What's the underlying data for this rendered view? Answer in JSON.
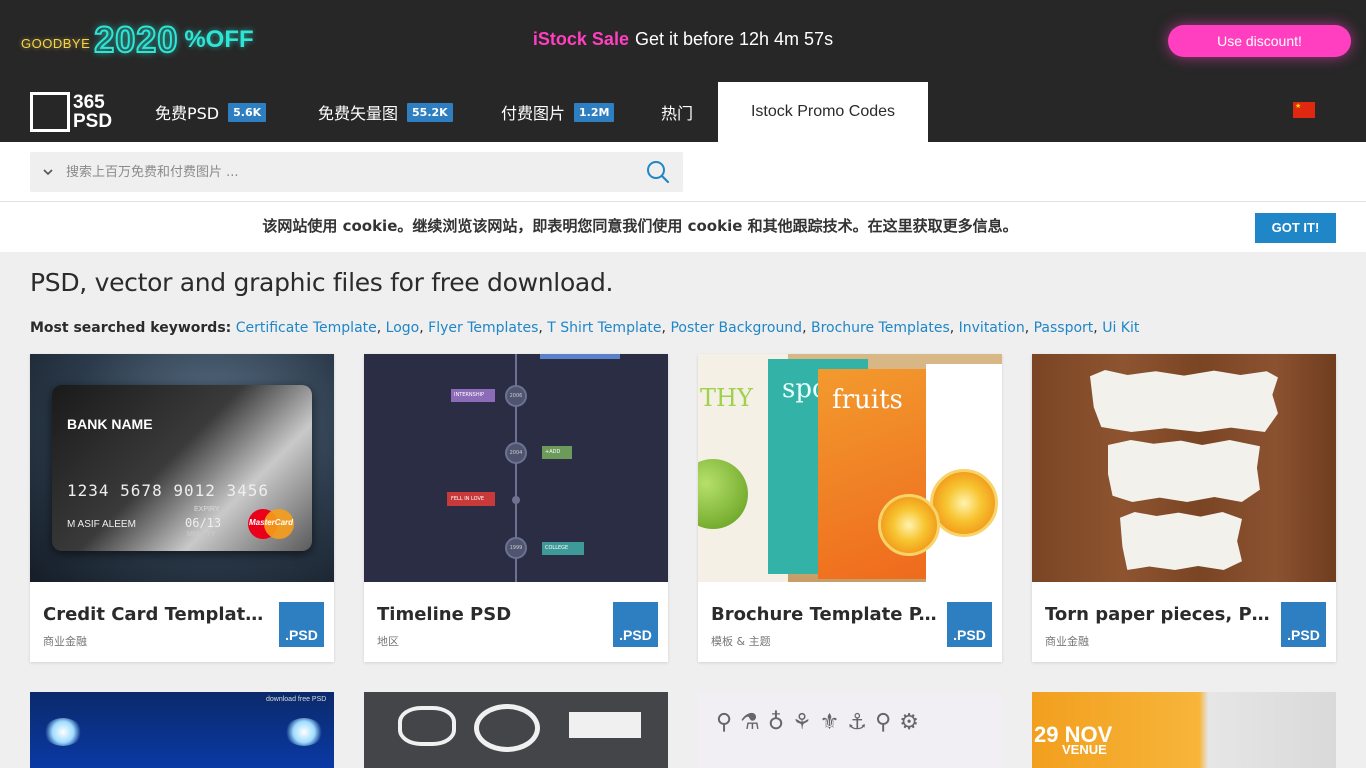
{
  "promo": {
    "goodbye": "GOODBYE",
    "year": "2020",
    "off": "%OFF",
    "brand": "iStock Sale",
    "message": "Get it before 12h 4m 57s",
    "button": "Use discount!"
  },
  "nav": {
    "logo_line1": "365",
    "logo_line2": "PSD",
    "items": [
      {
        "label": "免费PSD",
        "badge": "5.6K"
      },
      {
        "label": "免费矢量图",
        "badge": "55.2K"
      },
      {
        "label": "付费图片",
        "badge": "1.2M"
      },
      {
        "label": "热门",
        "badge": ""
      }
    ],
    "active": "Istock Promo Codes"
  },
  "search": {
    "placeholder": "搜索上百万免费和付费图片 ..."
  },
  "cookie": {
    "text": "该网站使用 cookie。继续浏览该网站，即表明您同意我们使用 cookie 和其他跟踪技术。在这里获取更多信息。",
    "button": "GOT IT!"
  },
  "page_title": "PSD, vector and graphic files for free download.",
  "keywords": {
    "label": "Most searched keywords:",
    "items": [
      "Certificate Template",
      "Logo",
      "Flyer Templates",
      "T Shirt Template",
      "Poster Background",
      "Brochure Templates",
      "Invitation",
      "Passport",
      "Ui Kit"
    ]
  },
  "cards": [
    {
      "title": "Credit Card Template ...",
      "category": "商业金融",
      "badge": ".PSD",
      "thumb": {
        "bank": "BANK NAME",
        "number": "1234 5678 9012 3456",
        "holder": "M ASIF ALEEM",
        "expiry_label": "EXPIRY",
        "expiry": "06/13",
        "mm_yy": "MM    YY",
        "brand": "MasterCard"
      }
    },
    {
      "title": "Timeline PSD",
      "category": "地区",
      "badge": ".PSD",
      "thumb": {
        "years": [
          "2006",
          "2004",
          "1999"
        ],
        "tags": [
          "INTERNSHIP",
          "+ADD",
          "FELL IN LOVE",
          "COLLEGE"
        ]
      }
    },
    {
      "title": "Brochure Template P...",
      "category": "模板 & 主题",
      "badge": ".PSD",
      "thumb": {
        "words": [
          "THY",
          "spo",
          "fruits"
        ]
      }
    },
    {
      "title": "Torn paper pieces, PS...",
      "category": "商业金融",
      "badge": ".PSD",
      "thumb": {}
    }
  ],
  "second_row": {
    "thumb1_text": "download free PSD",
    "thumb4_date": "29 NOV",
    "thumb4_venue": "VENUE"
  }
}
